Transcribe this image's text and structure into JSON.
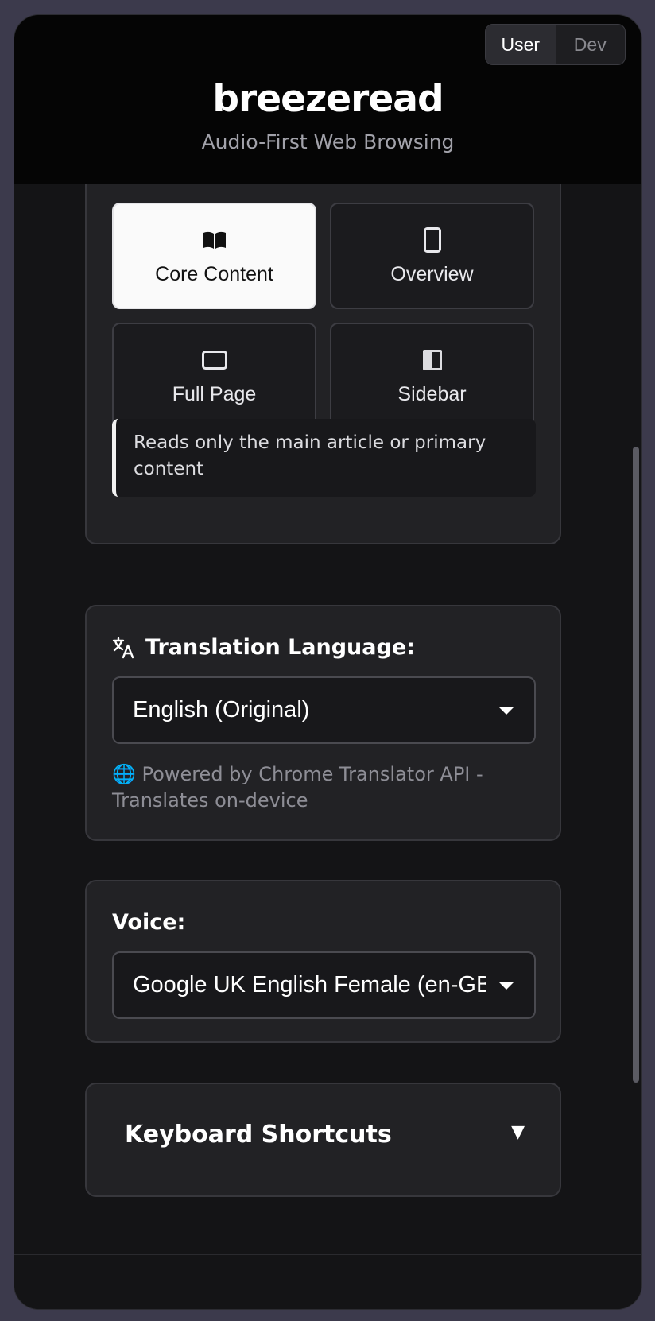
{
  "header": {
    "title": "breezeread",
    "subtitle": "Audio-First Web Browsing",
    "mode_toggle": {
      "user": "User",
      "dev": "Dev",
      "active": "User"
    }
  },
  "reading_mode": {
    "options": [
      {
        "label": "Core Content",
        "icon": "open-book-icon",
        "selected": true
      },
      {
        "label": "Overview",
        "icon": "phone-outline-icon",
        "selected": false
      },
      {
        "label": "Full Page",
        "icon": "rectangle-outline-icon",
        "selected": false
      },
      {
        "label": "Sidebar",
        "icon": "half-filled-panel-icon",
        "selected": false
      }
    ],
    "description": "Reads only the main article or primary content"
  },
  "translation": {
    "label": "Translation Language:",
    "icon": "translate-icon",
    "selected": "English (Original)",
    "note": "🌐 Powered by Chrome Translator API - Translates on-device"
  },
  "voice": {
    "label": "Voice:",
    "selected": "Google UK English Female (en-GB)"
  },
  "shortcuts": {
    "label": "Keyboard Shortcuts",
    "toggle": "▼"
  },
  "colors": {
    "background": "#141416",
    "card": "#222225",
    "selected_tile": "#fafafa",
    "accent_text": "#ffffff",
    "muted_text": "#8e8e96"
  }
}
